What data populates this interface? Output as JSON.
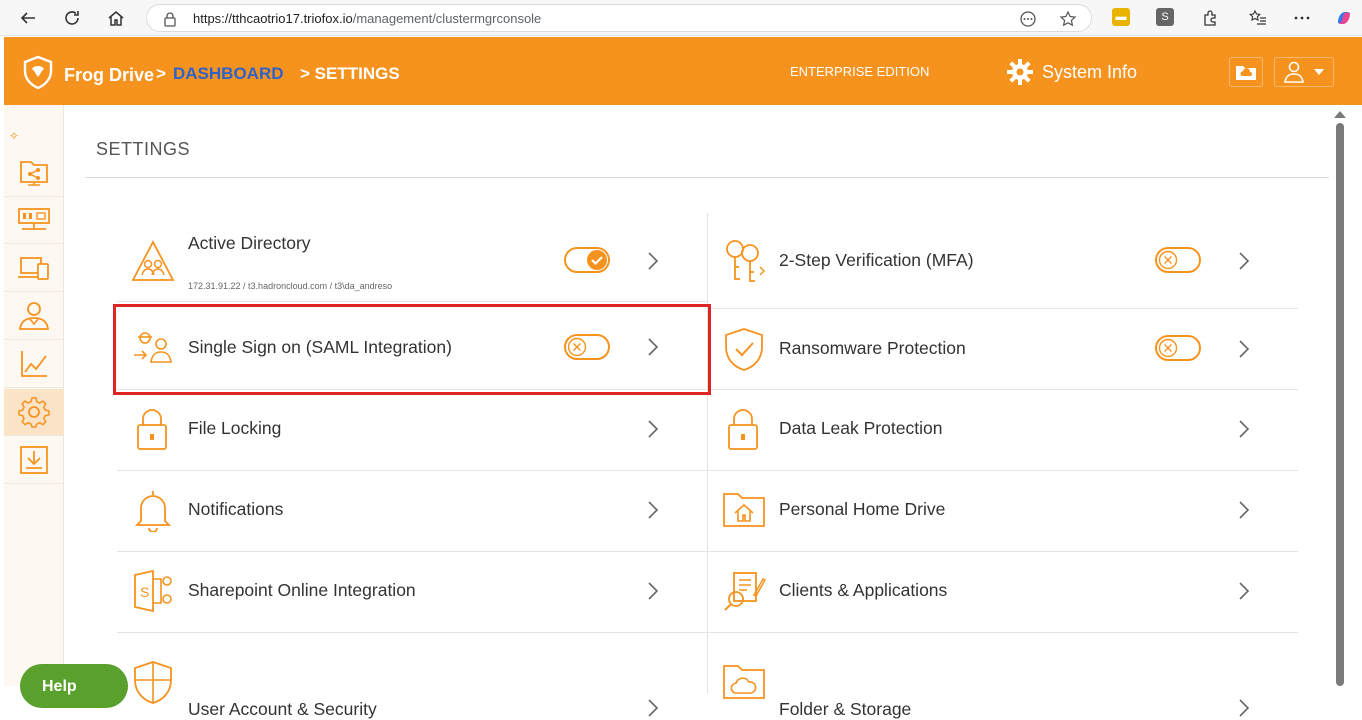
{
  "browser": {
    "url_host": "https://tthcaotrio17.triofox.io",
    "url_path": "/management/clustermgrconsole"
  },
  "header": {
    "brand": "Frog Drive",
    "sep": ">",
    "crumb_dashboard": "DASHBOARD",
    "crumb_current": "> SETTINGS",
    "edition": "ENTERPRISE EDITION",
    "system_info": "System Info"
  },
  "page": {
    "title": "SETTINGS"
  },
  "left_column": [
    {
      "label": "Active Directory",
      "sub": "172.31.91.22 / t3.hadroncloud.com / t3\\da_andreso",
      "toggle": "on"
    },
    {
      "label": "Single Sign on (SAML Integration)",
      "toggle": "off"
    },
    {
      "label": "File Locking"
    },
    {
      "label": "Notifications"
    },
    {
      "label": "Sharepoint Online Integration"
    },
    {
      "label": "User Account & Security"
    }
  ],
  "right_column": [
    {
      "label": "2-Step Verification (MFA)",
      "toggle": "off"
    },
    {
      "label": "Ransomware Protection",
      "toggle": "off"
    },
    {
      "label": "Data Leak Protection"
    },
    {
      "label": "Personal Home Drive"
    },
    {
      "label": "Clients & Applications"
    },
    {
      "label": "Folder & Storage"
    }
  ],
  "help": {
    "label": "Help"
  },
  "colors": {
    "accent": "#f6931e",
    "link": "#2e62c9",
    "highlight": "#e02424"
  }
}
